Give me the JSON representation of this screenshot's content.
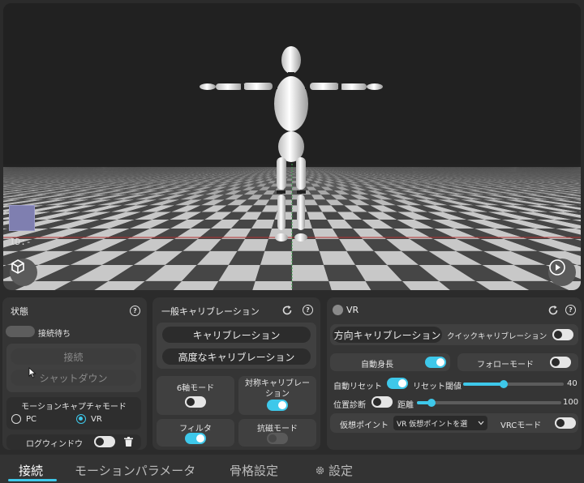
{
  "viewport": {
    "id_label": "ID:-"
  },
  "status_panel": {
    "title": "状態",
    "status_text": "接続待ち",
    "connect_label": "接続",
    "shutdown_label": "シャットダウン",
    "mocap_mode_label": "モーションキャプチャモード",
    "mode_pc_label": "PC",
    "mode_vr_label": "VR",
    "selected_mode": "VR",
    "log_window_label": "ログウィンドウ"
  },
  "calibration_panel": {
    "title": "一般キャリブレーション",
    "calibration_label": "キャリブレーション",
    "advanced_calibration_label": "高度なキャリブレーション",
    "six_axis_label": "6軸モード",
    "symmetric_label": "対称キャリブレーション",
    "filter_label": "フィルタ",
    "antimagnetic_label": "抗磁モード"
  },
  "vr_panel": {
    "title": "VR",
    "direction_calibration_label": "方向キャリブレーション",
    "quick_calibration_label": "クイックキャリブレーション",
    "auto_height_label": "自動身長",
    "follow_mode_label": "フォローモード",
    "auto_reset_label": "自動リセット",
    "reset_threshold_label": "リセット閾値",
    "reset_threshold_value": "40",
    "reset_threshold_fraction": 0.4,
    "position_diag_label": "位置診断",
    "distance_label": "距離",
    "distance_value": "100",
    "distance_fraction": 0.1,
    "virtual_point_label": "仮想ポイント",
    "virtual_point_select": "VR 仮想ポイントを選",
    "vrc_mode_label": "VRCモード"
  },
  "tabs": [
    {
      "label": "接続"
    },
    {
      "label": "モーションパラメータ"
    },
    {
      "label": "骨格設定"
    },
    {
      "label": "設定"
    }
  ],
  "colors": {
    "accent": "#3ec8ea",
    "panel": "#353535",
    "background": "#2b2b2b"
  }
}
